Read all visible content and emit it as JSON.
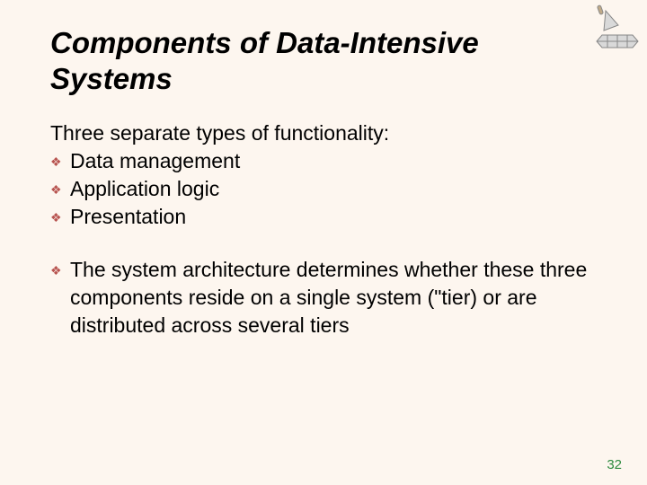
{
  "title": "Components of Data-Intensive Systems",
  "intro": "Three separate types of functionality:",
  "bullets": {
    "b0": "Data management",
    "b1": "Application logic",
    "b2": "Presentation"
  },
  "para2": "The system architecture determines whether these three components reside on a single system (\"tier) or are distributed across several tiers",
  "page_number": "32"
}
